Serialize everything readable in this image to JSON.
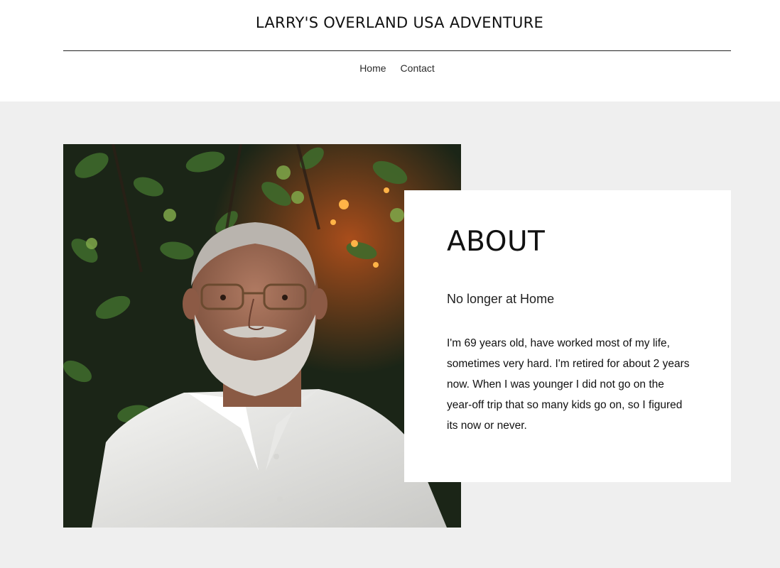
{
  "header": {
    "site_title": "LARRY'S OVERLAND USA ADVENTURE",
    "nav": [
      {
        "label": "Home"
      },
      {
        "label": "Contact"
      }
    ]
  },
  "about": {
    "heading": "ABOUT",
    "subtitle": "No longer at Home",
    "body": "I'm 69 years old, have worked most of my life, sometimes very hard. I'm retired for about 2 years now. When I was younger I did not go on the year-off trip that so many kids go on, so I figured its now or never."
  },
  "colors": {
    "page_background": "#efefef",
    "header_background": "#ffffff",
    "card_background": "#ffffff",
    "text": "#111111"
  }
}
